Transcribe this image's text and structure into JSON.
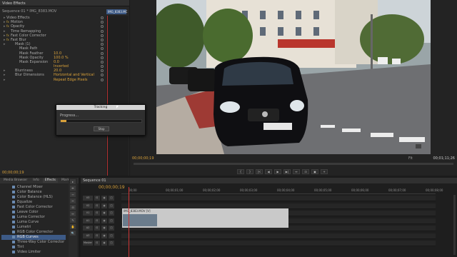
{
  "effect_controls": {
    "title": "Video Effects",
    "breadcrumb": "Sequence 01 * IMG_8383.MOV",
    "clip_chip": "IMG_8383.MC",
    "rows": [
      {
        "label": "Video Effects",
        "value": "",
        "indent": 0
      },
      {
        "label": "Motion",
        "value": "",
        "indent": 1,
        "fx": "fx"
      },
      {
        "label": "Opacity",
        "value": "",
        "indent": 1,
        "fx": "fx"
      },
      {
        "label": "Time Remapping",
        "value": "",
        "indent": 1,
        "fx": ""
      },
      {
        "label": "Fast Color Corrector",
        "value": "",
        "indent": 1,
        "fx": "fx"
      },
      {
        "label": "Fast Blur",
        "value": "",
        "indent": 1,
        "fx": "fx"
      },
      {
        "label": "Mask (1)",
        "value": "",
        "indent": 2
      },
      {
        "label": "Mask Path",
        "value": "",
        "indent": 3
      },
      {
        "label": "Mask Feather",
        "value": "10.0",
        "indent": 3
      },
      {
        "label": "Mask Opacity",
        "value": "100.0 %",
        "indent": 3
      },
      {
        "label": "Mask Expansion",
        "value": "0.0",
        "indent": 3
      },
      {
        "label": "",
        "value": "Inverted",
        "indent": 3
      },
      {
        "label": "Blurriness",
        "value": "20.0",
        "indent": 2
      },
      {
        "label": "Blur Dimensions",
        "value": "Horizontal and Vertical",
        "indent": 2
      },
      {
        "label": "",
        "value": "Repeat Edge Pixels",
        "indent": 2
      }
    ],
    "timecode": "00;00;00;19"
  },
  "program_monitor": {
    "timecode_left": "00;00;00;19",
    "fit_label": "Fit",
    "timecode_right": "00;01;11;26",
    "controls": [
      "{",
      "}",
      "|<",
      "◀",
      "▶",
      "▶|",
      "↔",
      "⊡",
      "▣",
      "+"
    ]
  },
  "tracking_dialog": {
    "title": "Tracking",
    "progress_label": "Progress...",
    "progress": 0.07,
    "stop_label": "Stop"
  },
  "effects_panel": {
    "tabs": [
      "Media Browser",
      "Info",
      "Effects",
      "Marker"
    ],
    "active_tab": "Effects",
    "items": [
      "Channel Mixer",
      "Color Balance",
      "Color Balance (HLS)",
      "Equalize",
      "Fast Color Corrector",
      "Leave Color",
      "Luma Corrector",
      "Luma Curve",
      "Lumetri",
      "RGB Color Corrector",
      "RGB Curves",
      "Three-Way Color Corrector",
      "Tint",
      "Video Limiter"
    ],
    "selected": "RGB Curves"
  },
  "tools": [
    "▸",
    "⇹",
    "⇿",
    "✂",
    "⊟",
    "↔",
    "✎",
    "✋",
    "🔍"
  ],
  "timeline": {
    "title": "Sequence 01",
    "timecode": "00;00;00;19",
    "ruler": [
      "00;00",
      "00;00;01;00",
      "00;00;02;00",
      "00;00;03;00",
      "00;00;04;00",
      "00;00;05;00",
      "00;00;06;00",
      "00;00;07;00",
      "00;00;08;00"
    ],
    "tracks": [
      {
        "name": "V3"
      },
      {
        "name": "V2"
      },
      {
        "name": "V1"
      },
      {
        "name": "A1"
      },
      {
        "name": "A2"
      },
      {
        "name": "A3"
      },
      {
        "name": "Master"
      }
    ],
    "clip_label": "IMG_8383.MOV [V]"
  }
}
